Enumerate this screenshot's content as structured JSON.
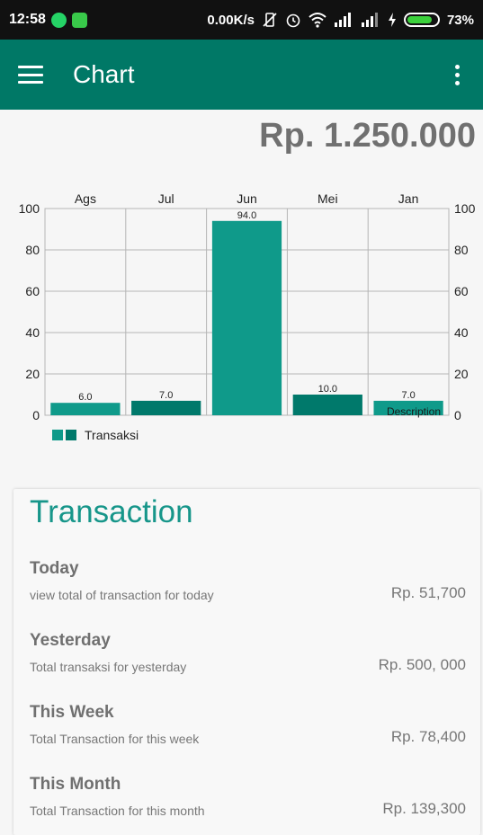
{
  "status_bar": {
    "time": "12:58",
    "net_speed": "0.00K/s",
    "battery": "73%"
  },
  "app_bar": {
    "title": "Chart",
    "menu_icon": "hamburger-menu-icon",
    "more_icon": "more-vert-icon"
  },
  "total": "Rp. 1.250.000",
  "chart_data": {
    "type": "bar",
    "categories": [
      "Ags",
      "Jul",
      "Jun",
      "Mei",
      "Jan"
    ],
    "series": [
      {
        "name": "Transaksi",
        "values": [
          6.0,
          7.0,
          94.0,
          10.0,
          7.0
        ]
      }
    ],
    "value_labels": [
      "6.0",
      "7.0",
      "94.0",
      "10.0",
      "7.0"
    ],
    "colors": [
      "#0f9a8a",
      "#00796b"
    ],
    "ylim": [
      0,
      100
    ],
    "yticks": [
      "0",
      "20",
      "40",
      "60",
      "80",
      "100"
    ],
    "description": "Description",
    "legend": "Transaksi",
    "grid": true
  },
  "transaction": {
    "title": "Transaction",
    "items": [
      {
        "label": "Today",
        "desc": "view total of transaction for today",
        "value": "Rp. 51,700"
      },
      {
        "label": "Yesterday",
        "desc": "Total transaksi for yesterday",
        "value": "Rp. 500, 000"
      },
      {
        "label": "This Week",
        "desc": "Total Transaction for this week",
        "value": "Rp. 78,400"
      },
      {
        "label": "This Month",
        "desc": "Total Transaction for this month",
        "value": "Rp. 139,300"
      }
    ]
  }
}
